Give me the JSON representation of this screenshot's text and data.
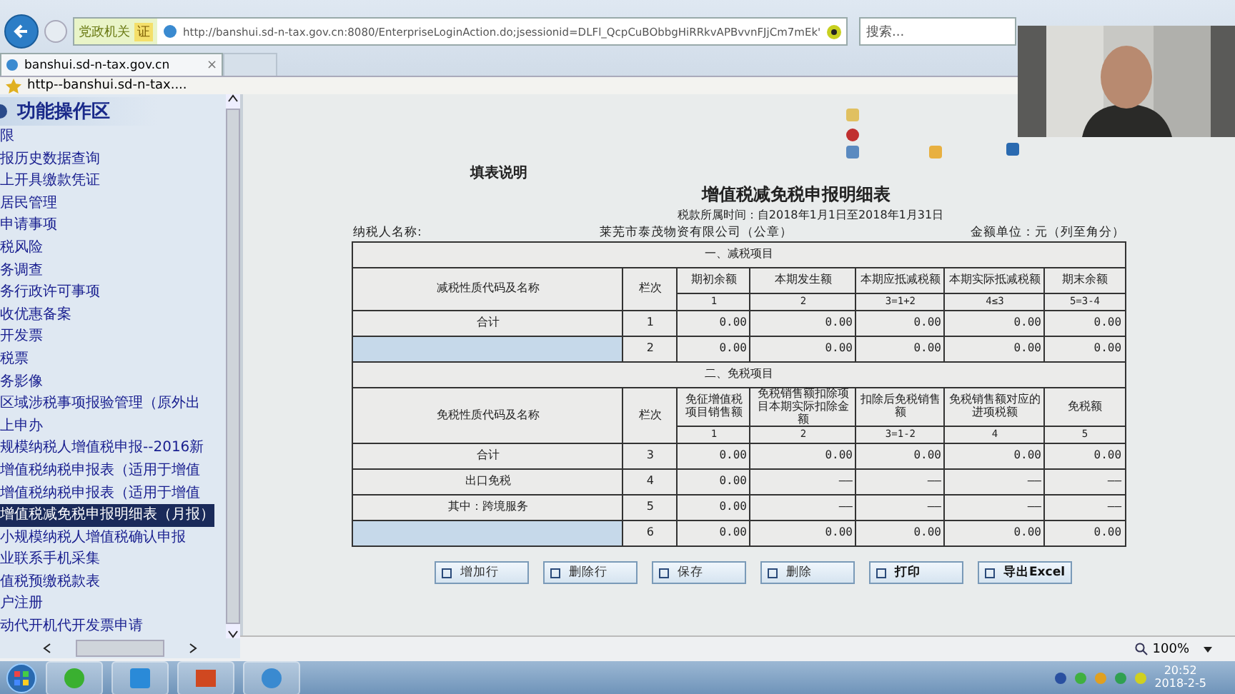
{
  "browser": {
    "security_label": "党政机关",
    "security_badge": "证",
    "url": "http://banshui.sd-n-tax.gov.cn:8080/EnterpriseLoginAction.do;jsessionid=DLFl_QcpCuBObbgHiRRkvAPBvvnFJjCm7mEk'",
    "search_placeholder": "搜索...",
    "tab_title": "banshui.sd-n-tax.gov.cn",
    "tab_close": "×",
    "favorite": "http--banshui.sd-n-tax...."
  },
  "sidebar": {
    "title": "功能操作区",
    "items": [
      {
        "label": "限",
        "selected": false
      },
      {
        "label": "报历史数据查询",
        "selected": false
      },
      {
        "label": "上开具缴款凭证",
        "selected": false
      },
      {
        "label": "居民管理",
        "selected": false
      },
      {
        "label": "申请事项",
        "selected": false
      },
      {
        "label": "税风险",
        "selected": false
      },
      {
        "label": "务调查",
        "selected": false
      },
      {
        "label": "务行政许可事项",
        "selected": false
      },
      {
        "label": "收优惠备案",
        "selected": false
      },
      {
        "label": "开发票",
        "selected": false
      },
      {
        "label": "税票",
        "selected": false
      },
      {
        "label": "务影像",
        "selected": false
      },
      {
        "label": "区域涉税事项报验管理（原外出",
        "selected": false
      },
      {
        "label": "上申办",
        "selected": false
      },
      {
        "label": "规模纳税人增值税申报--2016新",
        "selected": false
      },
      {
        "label": "增值税纳税申报表（适用于增值",
        "selected": false
      },
      {
        "label": "增值税纳税申报表（适用于增值",
        "selected": false
      },
      {
        "label": "增值税减免税申报明细表（月报）",
        "selected": true
      },
      {
        "label": "小规模纳税人增值税确认申报",
        "selected": false
      },
      {
        "label": "业联系手机采集",
        "selected": false
      },
      {
        "label": "值税预缴税款表",
        "selected": false
      },
      {
        "label": "户注册",
        "selected": false
      },
      {
        "label": "动代开机代开发票申请",
        "selected": false
      }
    ]
  },
  "form": {
    "instructions_link": "填表说明",
    "title": "增值税减免税申报明细表",
    "period": "税款所属时间：自2018年1月1日至2018年1月31日",
    "taxpayer_label": "纳税人名称:",
    "taxpayer_name": "莱芜市泰茂物资有限公司（公章）",
    "unit": "金额单位：元（列至角分）",
    "sections": [
      {
        "title": "一、减税项目",
        "name_header": "减税性质代码及名称",
        "line_header": "栏次",
        "columns": [
          "期初余额",
          "本期发生额",
          "本期应抵减税额",
          "本期实际抵减税额",
          "期末余额"
        ],
        "numbers": [
          "1",
          "2",
          "3=1+2",
          "4≤3",
          "5=3-4"
        ],
        "rows": [
          {
            "kind": "text",
            "name": "合计",
            "line": "1",
            "values": [
              "0.00",
              "0.00",
              "0.00",
              "0.00",
              "0.00"
            ]
          },
          {
            "kind": "input",
            "line": "2",
            "values": [
              "0.00",
              "0.00",
              "0.00",
              "0.00",
              "0.00"
            ]
          }
        ]
      },
      {
        "title": "二、免税项目",
        "name_header": "免税性质代码及名称",
        "line_header": "栏次",
        "columns": [
          "免征增值税项目销售额",
          "免税销售额扣除项目本期实际扣除金额",
          "扣除后免税销售额",
          "免税销售额对应的进项税额",
          "免税额"
        ],
        "numbers": [
          "1",
          "2",
          "3=1-2",
          "4",
          "5"
        ],
        "rows": [
          {
            "kind": "text",
            "name": "合计",
            "line": "3",
            "values": [
              "0.00",
              "0.00",
              "0.00",
              "0.00",
              "0.00"
            ]
          },
          {
            "kind": "text",
            "name": "出口免税",
            "line": "4",
            "values": [
              "0.00",
              "——",
              "——",
              "——",
              "——"
            ]
          },
          {
            "kind": "text",
            "name": "其中：跨境服务",
            "line": "5",
            "values": [
              "0.00",
              "——",
              "——",
              "——",
              "——"
            ]
          },
          {
            "kind": "input",
            "line": "6",
            "values": [
              "0.00",
              "0.00",
              "0.00",
              "0.00",
              "0.00"
            ]
          }
        ]
      }
    ],
    "buttons": [
      "增加行",
      "删除行",
      "保存",
      "删除",
      "打印",
      "导出Excel"
    ]
  },
  "status_bar": {
    "zoom": "100%"
  },
  "taskbar": {
    "time": "20:52",
    "date": "2018-2-5"
  }
}
